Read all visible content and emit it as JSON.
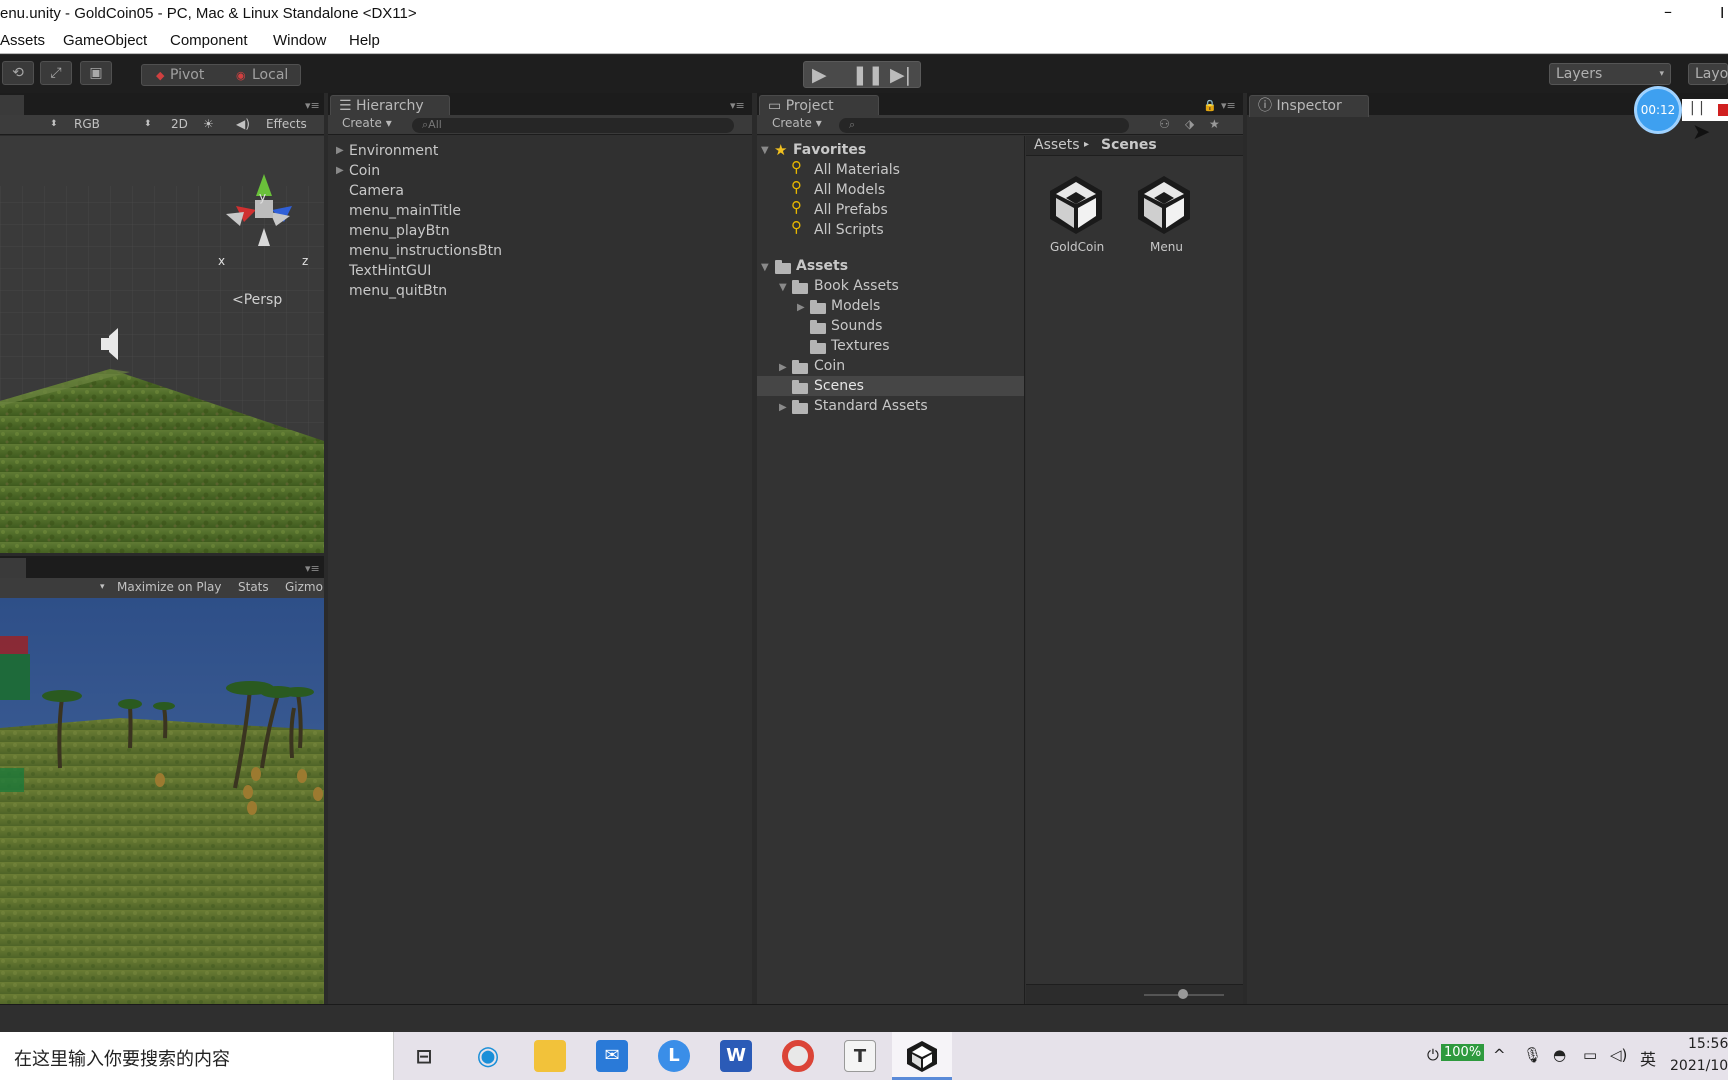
{
  "window": {
    "title": "enu.unity - GoldCoin05 - PC, Mac & Linux Standalone <DX11>",
    "minimize": "–",
    "edge_char": "I"
  },
  "menu": [
    "Assets",
    "GameObject",
    "Component",
    "Window",
    "Help"
  ],
  "toolbar": {
    "pivot": "Pivot",
    "local": "Local",
    "layers": "Layers",
    "layout": "Layo"
  },
  "scene": {
    "shading": "RGB",
    "mode_2d": "2D",
    "effects": "Effects",
    "persp": "Persp",
    "axis_x": "x",
    "axis_y": "y",
    "axis_z": "z"
  },
  "game": {
    "maximize": "Maximize on Play",
    "stats": "Stats",
    "gizmos": "Gizmo"
  },
  "hierarchy": {
    "tab": "Hierarchy",
    "create": "Create",
    "search_placeholder": "All",
    "items": [
      {
        "label": "Environment",
        "expandable": true
      },
      {
        "label": "Coin",
        "expandable": true
      },
      {
        "label": "Camera",
        "expandable": false
      },
      {
        "label": "menu_mainTitle",
        "expandable": false
      },
      {
        "label": "menu_playBtn",
        "expandable": false
      },
      {
        "label": "menu_instructionsBtn",
        "expandable": false
      },
      {
        "label": "TextHintGUI",
        "expandable": false
      },
      {
        "label": "menu_quitBtn",
        "expandable": false
      }
    ]
  },
  "project": {
    "tab": "Project",
    "create": "Create",
    "favorites": {
      "title": "Favorites",
      "items": [
        "All Materials",
        "All Models",
        "All Prefabs",
        "All Scripts"
      ]
    },
    "assets": {
      "title": "Assets",
      "tree": [
        "Book Assets",
        "Models",
        "Sounds",
        "Textures",
        "Coin",
        "Scenes",
        "Standard Assets"
      ],
      "selected": "Scenes"
    },
    "breadcrumb": {
      "root": "Assets",
      "current": "Scenes"
    },
    "files": [
      "GoldCoin",
      "Menu"
    ]
  },
  "inspector": {
    "tab": "Inspector"
  },
  "recorder": {
    "time": "00:12"
  },
  "taskbar": {
    "search_placeholder": "在这里输入你要搜索的内容",
    "word_letter": "W",
    "typora_letter": "T",
    "l_letter": "L",
    "battery": "100%",
    "ime": "英",
    "time": "15:56",
    "date": "2021/10"
  }
}
